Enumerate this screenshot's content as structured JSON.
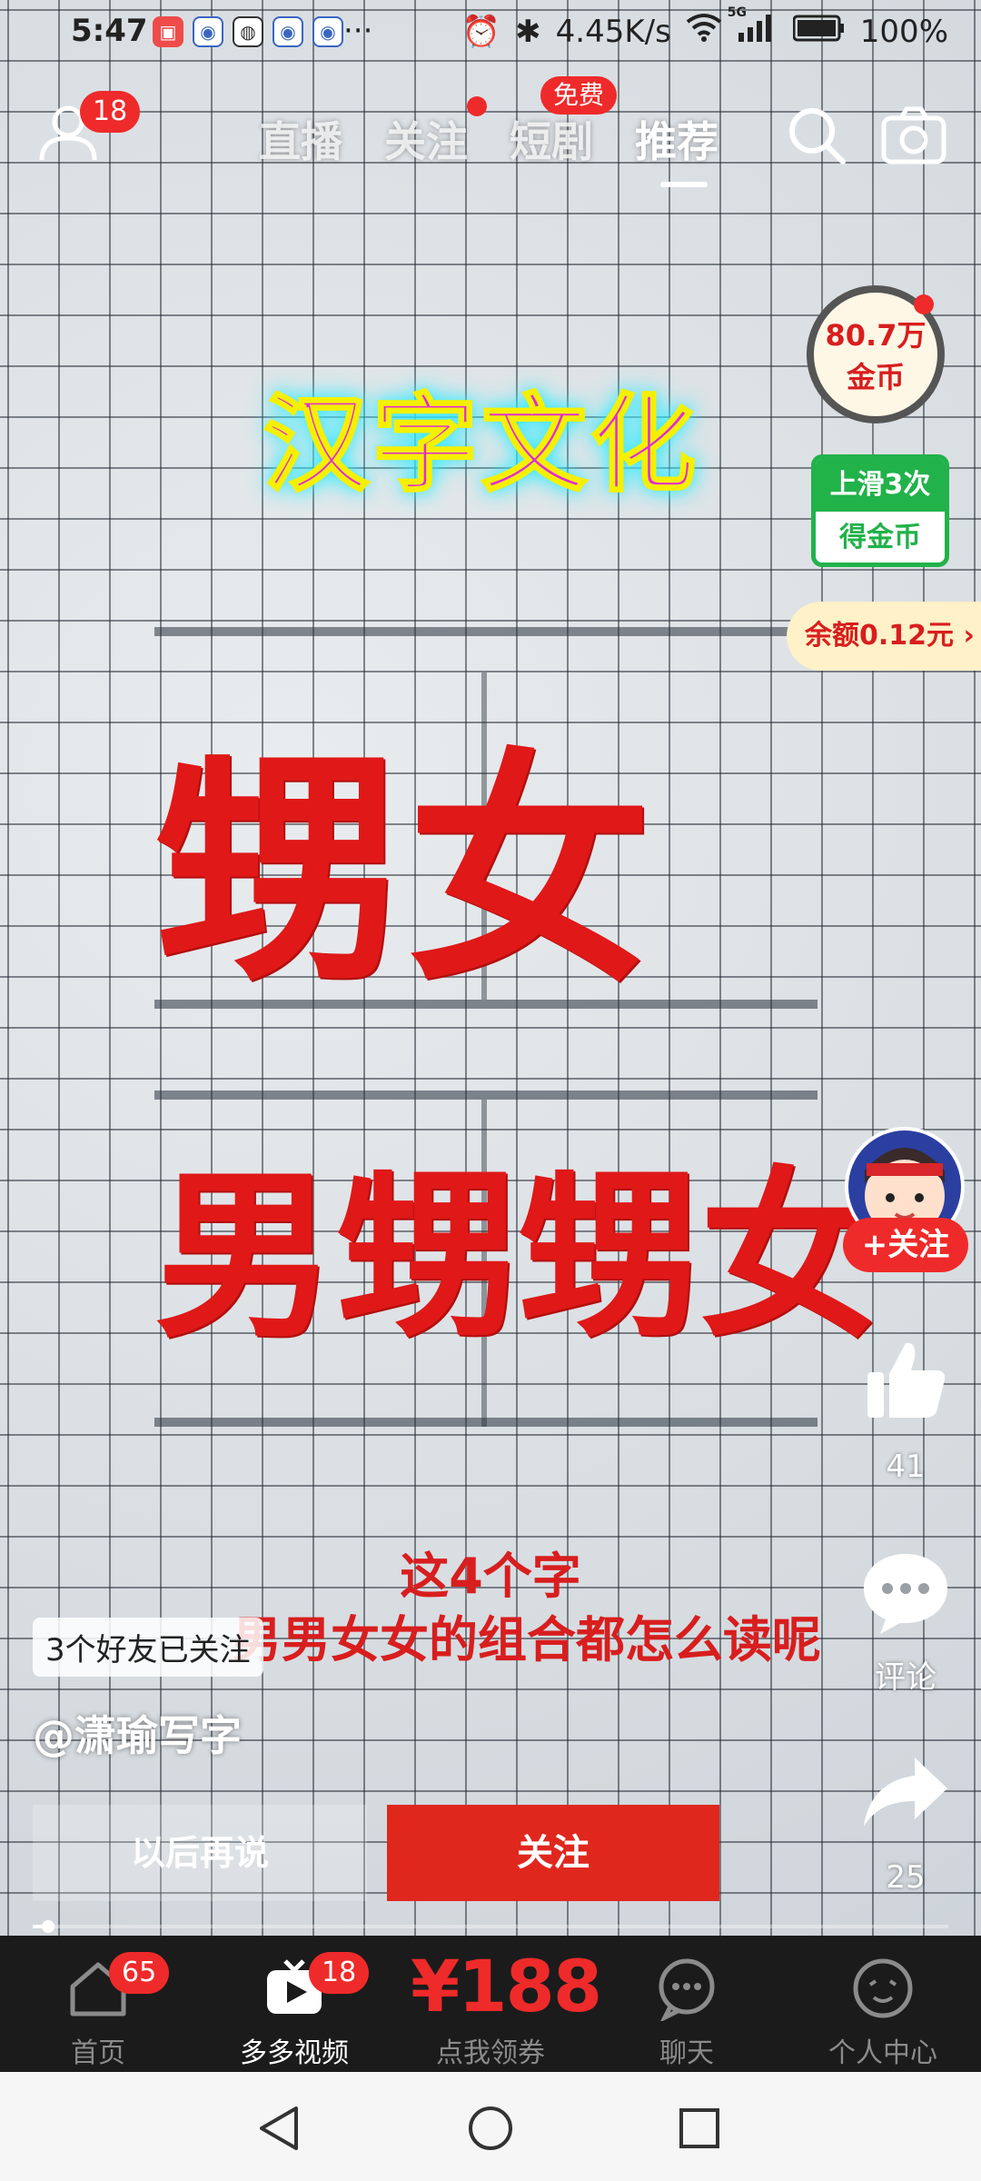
{
  "status_bar": {
    "time": "5:47",
    "more": "···",
    "net_speed": "4.45K/s",
    "battery": "100%",
    "net_type": "5G"
  },
  "top_nav": {
    "profile_badge": "18",
    "tabs": [
      {
        "label": "直播"
      },
      {
        "label": "关注"
      },
      {
        "label": "短剧"
      },
      {
        "label": "推荐"
      }
    ],
    "active_tab": "推荐",
    "free_badge": "免费"
  },
  "video": {
    "title": "汉字文化",
    "chars_row1": "甥女",
    "chars_row2": "男甥甥女",
    "caption_line1": "这4个字",
    "caption_line2": "男男女女的组合都怎么读呢"
  },
  "coins": {
    "amount": "80.7万",
    "unit": "金币"
  },
  "swipe_reward": {
    "line1": "上滑3次",
    "line2": "得金币"
  },
  "balance": {
    "text": "余额0.12元",
    "chevron": "›"
  },
  "actions": {
    "follow_pill": "+关注",
    "like_count": "41",
    "comment_label": "评论",
    "share_count": "25"
  },
  "overlay": {
    "friends_followed": "3个好友已关注",
    "author": "@潇瑜写字",
    "later_button": "以后再说",
    "follow_button": "关注",
    "progress": 0.01
  },
  "tab_bar": {
    "items": [
      {
        "label": "首页",
        "badge": "65"
      },
      {
        "label": "多多视频",
        "badge": "18"
      },
      {
        "label": "点我领券",
        "price": "¥188"
      },
      {
        "label": "聊天"
      },
      {
        "label": "个人中心"
      }
    ]
  },
  "colors": {
    "accent_red": "#ef2a2a",
    "green": "#21b24a",
    "tabbar_bg": "#1b1b1b"
  }
}
